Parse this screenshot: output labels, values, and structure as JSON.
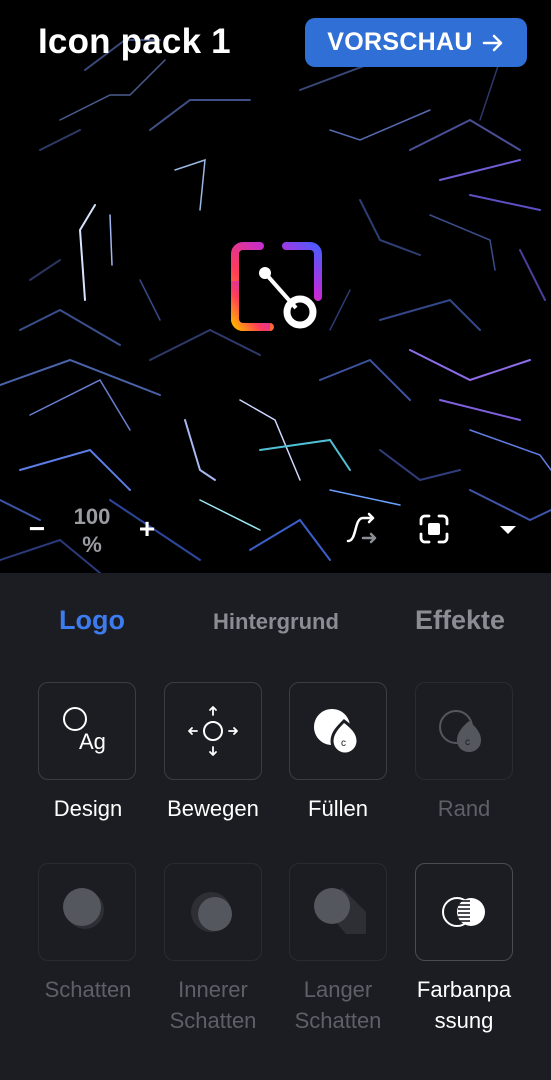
{
  "header": {
    "title": "Icon pack 1",
    "preview_label": "VORSCHAU"
  },
  "zoom": {
    "minus_label": "−",
    "value_line1": "100",
    "value_line2": "%",
    "plus_label": "+"
  },
  "tabs": [
    {
      "label": "Logo",
      "active": true
    },
    {
      "label": "Hintergrund",
      "active": false
    },
    {
      "label": "Effekte",
      "active": false
    }
  ],
  "tools": {
    "row1": [
      {
        "label": "Design",
        "icon": "circle-text-icon",
        "enabled": true
      },
      {
        "label": "Bewegen",
        "icon": "move-arrows-icon",
        "enabled": true
      },
      {
        "label": "Füllen",
        "icon": "fill-drops-icon",
        "enabled": true
      },
      {
        "label": "Rand",
        "icon": "border-drop-icon",
        "enabled": false
      }
    ],
    "row2": [
      {
        "label_line1": "Schatten",
        "label_line2": "",
        "icon": "shadow-icon",
        "enabled": false
      },
      {
        "label_line1": "Innerer",
        "label_line2": "Schatten",
        "icon": "inner-shadow-icon",
        "enabled": false
      },
      {
        "label_line1": "Langer",
        "label_line2": "Schatten",
        "icon": "long-shadow-icon",
        "enabled": false
      },
      {
        "label_line1": "Farbanpa",
        "label_line2": "ssung",
        "icon": "color-blend-icon",
        "enabled": true
      }
    ]
  },
  "colors": {
    "accent": "#2f6fd6",
    "tab_active": "#3d7cf0",
    "panel": "#1c1d22",
    "text_disabled": "#5d6068"
  }
}
